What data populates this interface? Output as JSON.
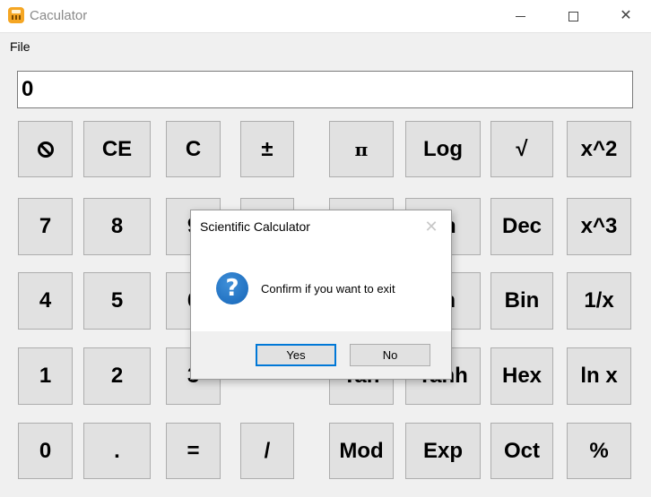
{
  "window": {
    "title": "Caculator",
    "minimize_glyph": "",
    "maximize_glyph": "",
    "close_glyph": "✕"
  },
  "menu": {
    "file": "File"
  },
  "display": {
    "value": "0"
  },
  "keys": [
    {
      "label": "⃠",
      "name": "clear-all-button",
      "icon": "prohibited-icon"
    },
    {
      "label": "CE",
      "name": "clear-entry-button"
    },
    {
      "label": "C",
      "name": "clear-button"
    },
    {
      "label": "±",
      "name": "plus-minus-button"
    },
    {
      "label": "π",
      "name": "pi-button"
    },
    {
      "label": "Log",
      "name": "log-button"
    },
    {
      "label": "√",
      "name": "sqrt-button"
    },
    {
      "label": "x^2",
      "name": "square-button"
    },
    {
      "label": "7",
      "name": "digit-7-button"
    },
    {
      "label": "8",
      "name": "digit-8-button"
    },
    {
      "label": "9",
      "name": "digit-9-button"
    },
    {
      "label": "",
      "name": "hidden-key-button"
    },
    {
      "label": "",
      "name": "hidden-trig-button"
    },
    {
      "label": "nh",
      "name": "sinh-button"
    },
    {
      "label": "Dec",
      "name": "dec-button"
    },
    {
      "label": "x^3",
      "name": "cube-button"
    },
    {
      "label": "4",
      "name": "digit-4-button"
    },
    {
      "label": "5",
      "name": "digit-5-button"
    },
    {
      "label": "6",
      "name": "digit-6-button"
    },
    {
      "label": "sh",
      "name": "cosh-button"
    },
    {
      "label": "Bin",
      "name": "bin-button"
    },
    {
      "label": "1/x",
      "name": "reciprocal-button"
    },
    {
      "label": "1",
      "name": "digit-1-button"
    },
    {
      "label": "2",
      "name": "digit-2-button"
    },
    {
      "label": "3",
      "name": "digit-3-button"
    },
    {
      "label": "Tan",
      "name": "tan-button"
    },
    {
      "label": "Tanh",
      "name": "tanh-button"
    },
    {
      "label": "Hex",
      "name": "hex-button"
    },
    {
      "label": "ln x",
      "name": "ln-button"
    },
    {
      "label": "0",
      "name": "digit-0-button"
    },
    {
      "label": ".",
      "name": "decimal-button"
    },
    {
      "label": "=",
      "name": "equals-button"
    },
    {
      "label": "/",
      "name": "divide-button"
    },
    {
      "label": "Mod",
      "name": "mod-button"
    },
    {
      "label": "Exp",
      "name": "exp-button"
    },
    {
      "label": "Oct",
      "name": "oct-button"
    },
    {
      "label": "%",
      "name": "percent-button"
    }
  ],
  "dialog": {
    "title": "Scientific Calculator",
    "message": "Confirm if you want to exit",
    "close_glyph": "✕",
    "icon": "question-icon",
    "yes": "Yes",
    "no": "No"
  },
  "colors": {
    "accent": "#0078d7",
    "question_icon": "#1565b8",
    "app_icon": "#f5a623"
  }
}
